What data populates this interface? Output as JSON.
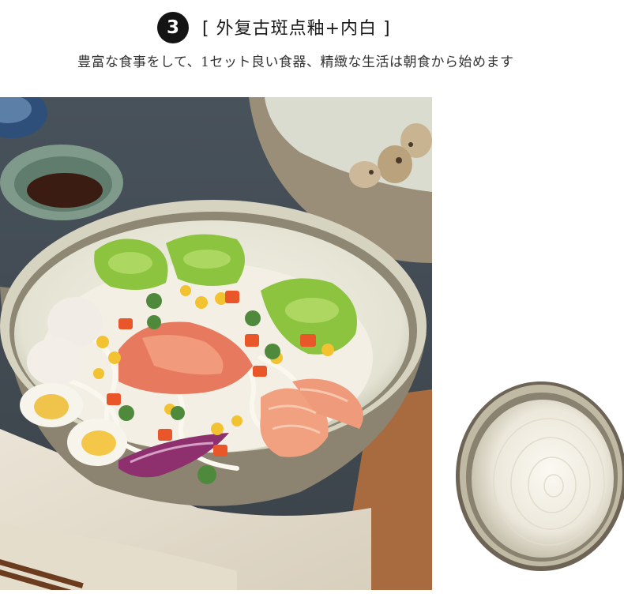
{
  "header": {
    "step_number": "3",
    "title": "[  外复古斑点釉+内白 ]",
    "subtitle": "豊富な食事をして、1セット良い食器、精緻な生活は朝食から始めます"
  },
  "images": {
    "main_photo": "noodle-salad-bowl-photo",
    "detail_photo": "bowl-interior-top-view"
  }
}
